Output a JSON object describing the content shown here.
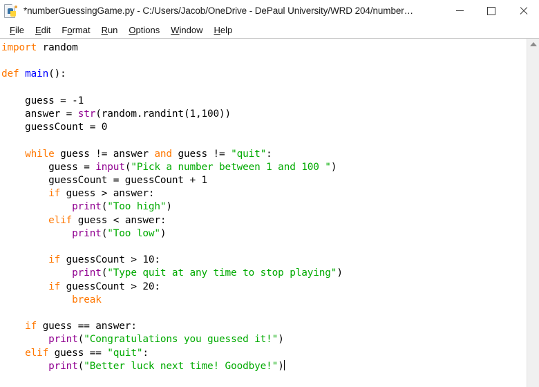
{
  "window": {
    "title": "*numberGuessingGame.py - C:/Users/Jacob/OneDrive - DePaul University/WRD 204/number…",
    "icon": "python-file-icon",
    "controls": {
      "minimize_label": "Minimize",
      "maximize_label": "Maximize",
      "close_label": "Close"
    }
  },
  "menubar": {
    "items": [
      {
        "label": "File",
        "mnemonic": "F",
        "rest": "ile"
      },
      {
        "label": "Edit",
        "mnemonic": "E",
        "rest": "dit"
      },
      {
        "label": "Format",
        "pre": "F",
        "mnemonic": "o",
        "rest": "rmat"
      },
      {
        "label": "Run",
        "mnemonic": "R",
        "rest": "un"
      },
      {
        "label": "Options",
        "mnemonic": "O",
        "rest": "ptions"
      },
      {
        "label": "Window",
        "mnemonic": "W",
        "rest": "indow"
      },
      {
        "label": "Help",
        "mnemonic": "H",
        "rest": "elp"
      }
    ]
  },
  "editor": {
    "language": "python",
    "caret_visible": true,
    "colors": {
      "keyword": "#FF7700",
      "definition": "#0000FF",
      "builtin": "#900090",
      "string": "#00AA00",
      "text": "#000000",
      "background": "#FFFFFF"
    },
    "lines": [
      [
        {
          "t": "import",
          "c": "kw"
        },
        {
          "t": " random",
          "c": "plain"
        }
      ],
      [],
      [
        {
          "t": "def",
          "c": "kw"
        },
        {
          "t": " ",
          "c": "plain"
        },
        {
          "t": "main",
          "c": "defn"
        },
        {
          "t": "():",
          "c": "plain"
        }
      ],
      [],
      [
        {
          "t": "    guess = -1",
          "c": "plain"
        }
      ],
      [
        {
          "t": "    answer = ",
          "c": "plain"
        },
        {
          "t": "str",
          "c": "bi"
        },
        {
          "t": "(random.randint(1,100))",
          "c": "plain"
        }
      ],
      [
        {
          "t": "    guessCount = 0",
          "c": "plain"
        }
      ],
      [],
      [
        {
          "t": "    ",
          "c": "plain"
        },
        {
          "t": "while",
          "c": "kw"
        },
        {
          "t": " guess != answer ",
          "c": "plain"
        },
        {
          "t": "and",
          "c": "kw"
        },
        {
          "t": " guess != ",
          "c": "plain"
        },
        {
          "t": "\"quit\"",
          "c": "str"
        },
        {
          "t": ":",
          "c": "plain"
        }
      ],
      [
        {
          "t": "        guess = ",
          "c": "plain"
        },
        {
          "t": "input",
          "c": "bi"
        },
        {
          "t": "(",
          "c": "plain"
        },
        {
          "t": "\"Pick a number between 1 and 100 \"",
          "c": "str"
        },
        {
          "t": ")",
          "c": "plain"
        }
      ],
      [
        {
          "t": "        guessCount = guessCount + 1",
          "c": "plain"
        }
      ],
      [
        {
          "t": "        ",
          "c": "plain"
        },
        {
          "t": "if",
          "c": "kw"
        },
        {
          "t": " guess > answer:",
          "c": "plain"
        }
      ],
      [
        {
          "t": "            ",
          "c": "plain"
        },
        {
          "t": "print",
          "c": "bi"
        },
        {
          "t": "(",
          "c": "plain"
        },
        {
          "t": "\"Too high\"",
          "c": "str"
        },
        {
          "t": ")",
          "c": "plain"
        }
      ],
      [
        {
          "t": "        ",
          "c": "plain"
        },
        {
          "t": "elif",
          "c": "kw"
        },
        {
          "t": " guess < answer:",
          "c": "plain"
        }
      ],
      [
        {
          "t": "            ",
          "c": "plain"
        },
        {
          "t": "print",
          "c": "bi"
        },
        {
          "t": "(",
          "c": "plain"
        },
        {
          "t": "\"Too low\"",
          "c": "str"
        },
        {
          "t": ")",
          "c": "plain"
        }
      ],
      [],
      [
        {
          "t": "        ",
          "c": "plain"
        },
        {
          "t": "if",
          "c": "kw"
        },
        {
          "t": " guessCount > 10:",
          "c": "plain"
        }
      ],
      [
        {
          "t": "            ",
          "c": "plain"
        },
        {
          "t": "print",
          "c": "bi"
        },
        {
          "t": "(",
          "c": "plain"
        },
        {
          "t": "\"Type quit at any time to stop playing\"",
          "c": "str"
        },
        {
          "t": ")",
          "c": "plain"
        }
      ],
      [
        {
          "t": "        ",
          "c": "plain"
        },
        {
          "t": "if",
          "c": "kw"
        },
        {
          "t": " guessCount > 20:",
          "c": "plain"
        }
      ],
      [
        {
          "t": "            ",
          "c": "plain"
        },
        {
          "t": "break",
          "c": "kw"
        }
      ],
      [],
      [
        {
          "t": "    ",
          "c": "plain"
        },
        {
          "t": "if",
          "c": "kw"
        },
        {
          "t": " guess == answer:",
          "c": "plain"
        }
      ],
      [
        {
          "t": "        ",
          "c": "plain"
        },
        {
          "t": "print",
          "c": "bi"
        },
        {
          "t": "(",
          "c": "plain"
        },
        {
          "t": "\"Congratulations you guessed it!\"",
          "c": "str"
        },
        {
          "t": ")",
          "c": "plain"
        }
      ],
      [
        {
          "t": "    ",
          "c": "plain"
        },
        {
          "t": "elif",
          "c": "kw"
        },
        {
          "t": " guess == ",
          "c": "plain"
        },
        {
          "t": "\"quit\"",
          "c": "str"
        },
        {
          "t": ":",
          "c": "plain"
        }
      ],
      [
        {
          "t": "        ",
          "c": "plain"
        },
        {
          "t": "print",
          "c": "bi"
        },
        {
          "t": "(",
          "c": "plain"
        },
        {
          "t": "\"Better luck next time! Goodbye!\"",
          "c": "str"
        },
        {
          "t": ")",
          "c": "plain"
        },
        {
          "t": "__CARET__",
          "c": "caret"
        }
      ]
    ]
  },
  "scrollbar": {
    "orientation": "vertical",
    "up_arrow": "scroll-up-arrow"
  }
}
